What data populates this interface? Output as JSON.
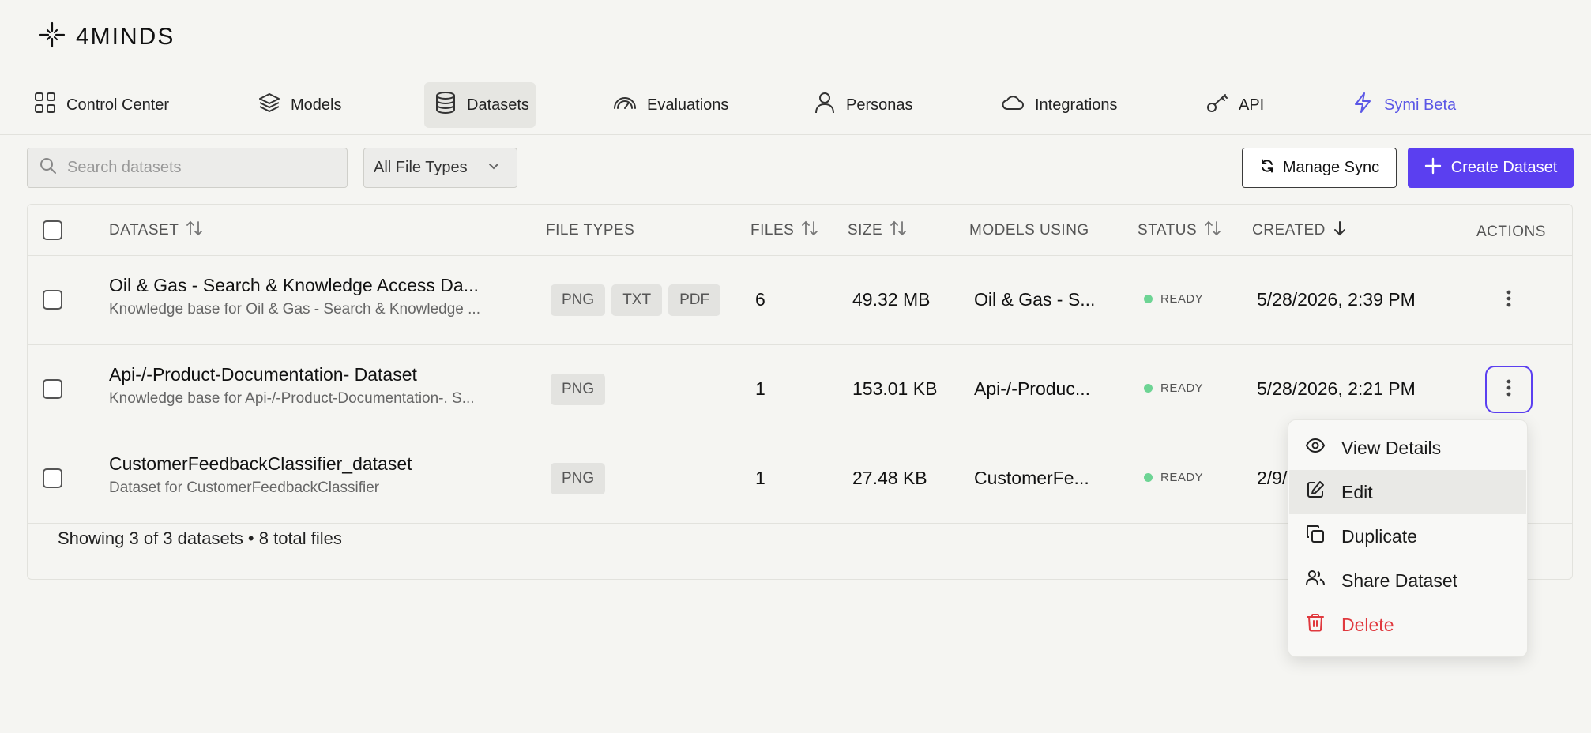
{
  "app": {
    "logo_text": "4MINDS"
  },
  "nav": {
    "items": [
      {
        "label": "Control Center",
        "icon": "grid-icon"
      },
      {
        "label": "Models",
        "icon": "layers-icon"
      },
      {
        "label": "Datasets",
        "icon": "database-icon",
        "active": true
      },
      {
        "label": "Evaluations",
        "icon": "gauge-icon"
      },
      {
        "label": "Personas",
        "icon": "user-icon"
      },
      {
        "label": "Integrations",
        "icon": "cloud-icon"
      },
      {
        "label": "API",
        "icon": "key-icon"
      },
      {
        "label": "Symi Beta",
        "icon": "lightning-icon"
      }
    ]
  },
  "toolbar": {
    "search_placeholder": "Search datasets",
    "file_type_selected": "All File Types",
    "manage_sync_label": "Manage Sync",
    "create_dataset_label": "Create Dataset"
  },
  "table": {
    "headers": {
      "dataset": "DATASET",
      "file_types": "FILE TYPES",
      "files": "FILES",
      "size": "SIZE",
      "models_using": "MODELS USING",
      "status": "STATUS",
      "created": "CREATED",
      "actions": "ACTIONS"
    },
    "rows": [
      {
        "name": "Oil & Gas - Search & Knowledge Access Da...",
        "description": "Knowledge base for Oil & Gas - Search & Knowledge ...",
        "file_types": [
          "PNG",
          "TXT",
          "PDF"
        ],
        "files": "6",
        "size": "49.32 MB",
        "models_using": "Oil & Gas - S...",
        "status": "READY",
        "created": "5/28/2026, 2:39 PM"
      },
      {
        "name": "Api-/-Product-Documentation- Dataset",
        "description": "Knowledge base for Api-/-Product-Documentation-. S...",
        "file_types": [
          "PNG"
        ],
        "files": "1",
        "size": "153.01 KB",
        "models_using": "Api-/-Produc...",
        "status": "READY",
        "created": "5/28/2026, 2:21 PM"
      },
      {
        "name": "CustomerFeedbackClassifier_dataset",
        "description": "Dataset for CustomerFeedbackClassifier",
        "file_types": [
          "PNG"
        ],
        "files": "1",
        "size": "27.48 KB",
        "models_using": "CustomerFe...",
        "status": "READY",
        "created": "2/9/"
      }
    ],
    "footer": "Showing 3 of 3 datasets • 8 total files"
  },
  "actions_menu": {
    "items": [
      {
        "label": "View Details",
        "icon": "eye-icon"
      },
      {
        "label": "Edit",
        "icon": "edit-icon"
      },
      {
        "label": "Duplicate",
        "icon": "copy-icon"
      },
      {
        "label": "Share Dataset",
        "icon": "users-icon"
      },
      {
        "label": "Delete",
        "icon": "trash-icon"
      }
    ]
  },
  "colors": {
    "accent": "#5b3ff0",
    "status_ready": "#6dd494",
    "danger": "#e0393e"
  }
}
